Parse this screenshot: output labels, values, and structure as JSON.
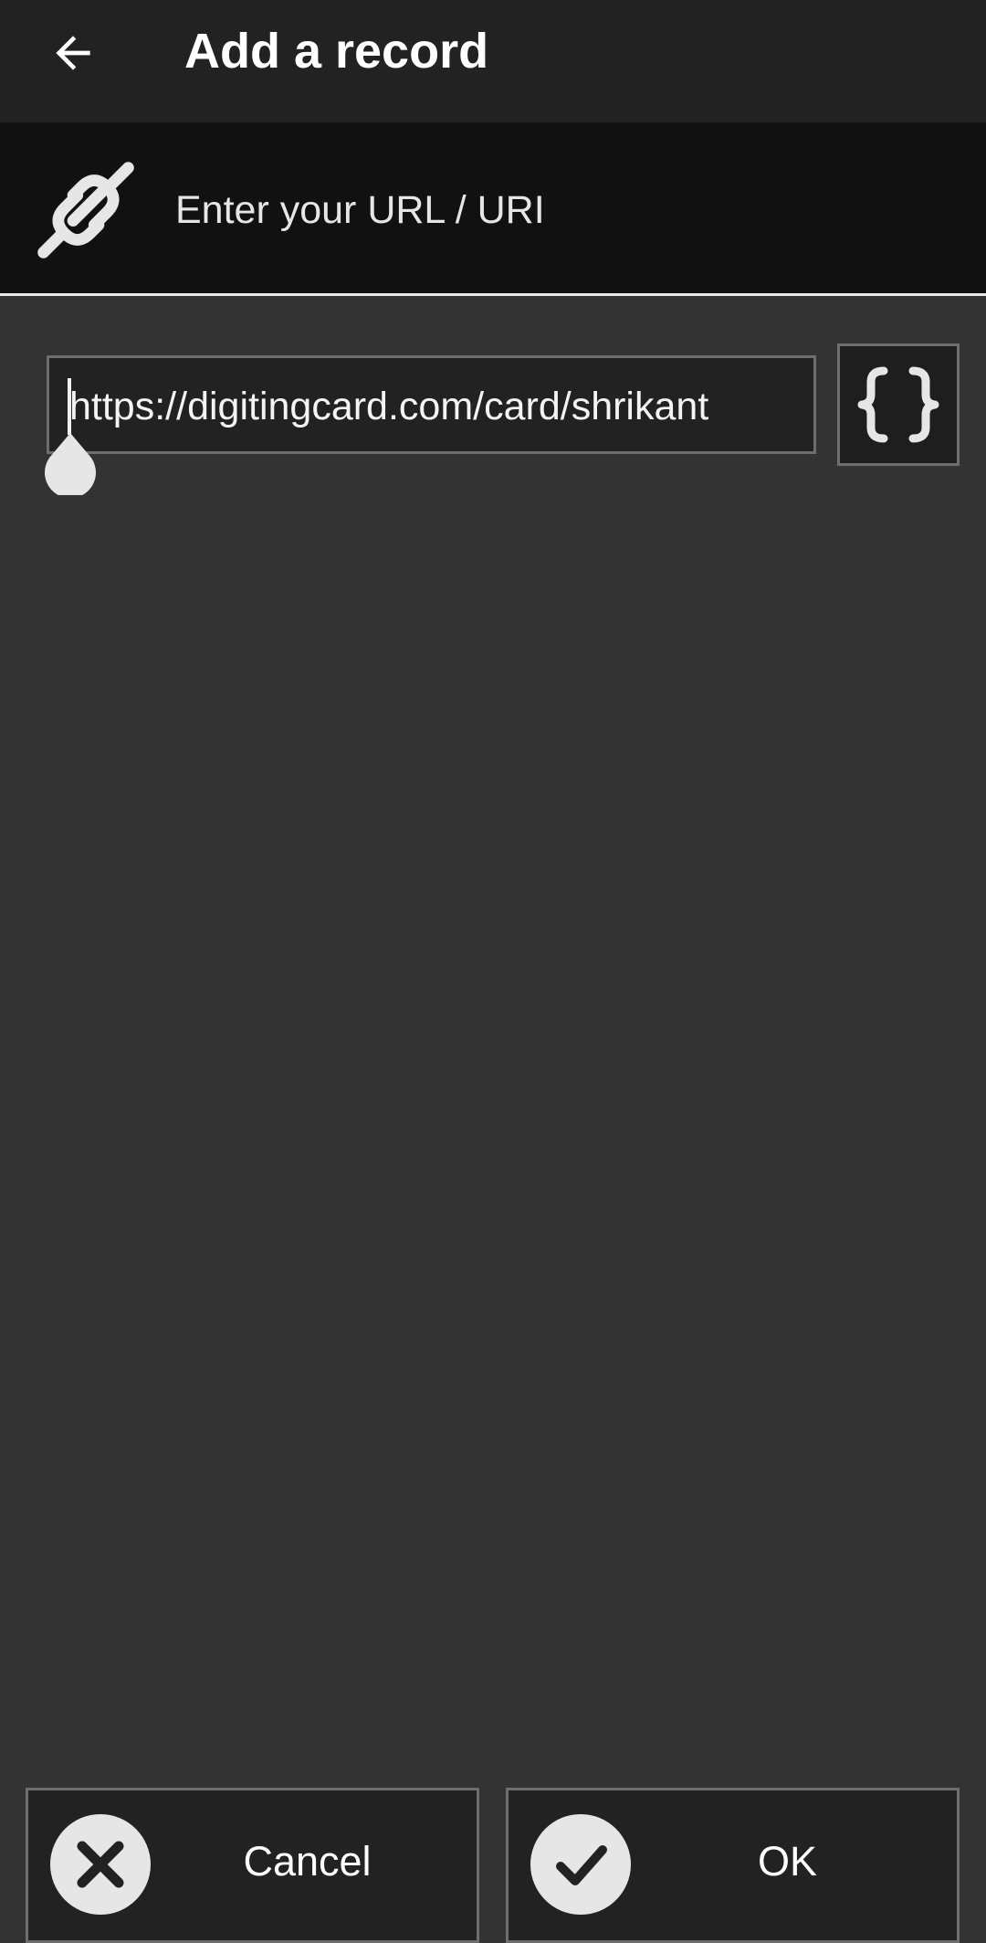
{
  "app_bar": {
    "title": "Add a record",
    "back_icon": "arrow-left-icon"
  },
  "header": {
    "icon": "link-icon",
    "label": "Enter your URL / URI"
  },
  "url_input": {
    "value": "https://digitingcard.com/card/shrikant"
  },
  "variables_button": {
    "icon": "curly-braces-icon"
  },
  "actions": {
    "cancel_label": "Cancel",
    "ok_label": "OK"
  },
  "colors": {
    "background": "#333333",
    "app_bar": "#222222",
    "header": "#111111",
    "text": "#eeeeee"
  }
}
